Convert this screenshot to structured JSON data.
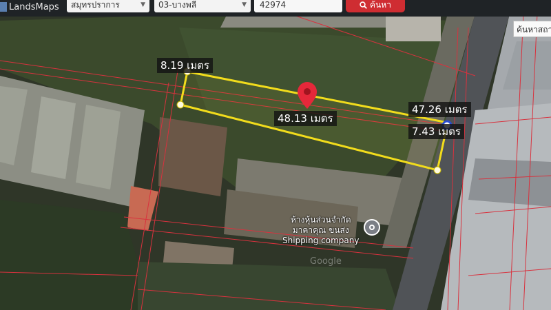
{
  "app": {
    "name": "LandsMaps"
  },
  "toolbar": {
    "province": "สมุทรปราการ",
    "district": "03-บางพลี",
    "parcel_number": "42974",
    "search_label": "ค้นหา"
  },
  "map": {
    "measurements": [
      {
        "id": "side-left",
        "text": "8.19 เมตร"
      },
      {
        "id": "side-top",
        "text": "48.13 เมตร"
      },
      {
        "id": "side-right",
        "text": "47.26 เมตร"
      },
      {
        "id": "side-bottom",
        "text": "7.43 เมตร"
      }
    ],
    "poi": {
      "line1": "ห้างหุ้นส่วนจำกัด",
      "line2": "มาคาคุณ ขนส่ง",
      "line3": "Shipping company"
    },
    "watermark": "Google",
    "search_place_label": "ค้นหาสถานที่"
  },
  "colors": {
    "parcel_outline": "#f2dc1c",
    "parcel_vertex": "#fffbe0",
    "pin": "#e5283a",
    "boundary_lines": "#d8323e",
    "search_button": "#cf2d32"
  }
}
